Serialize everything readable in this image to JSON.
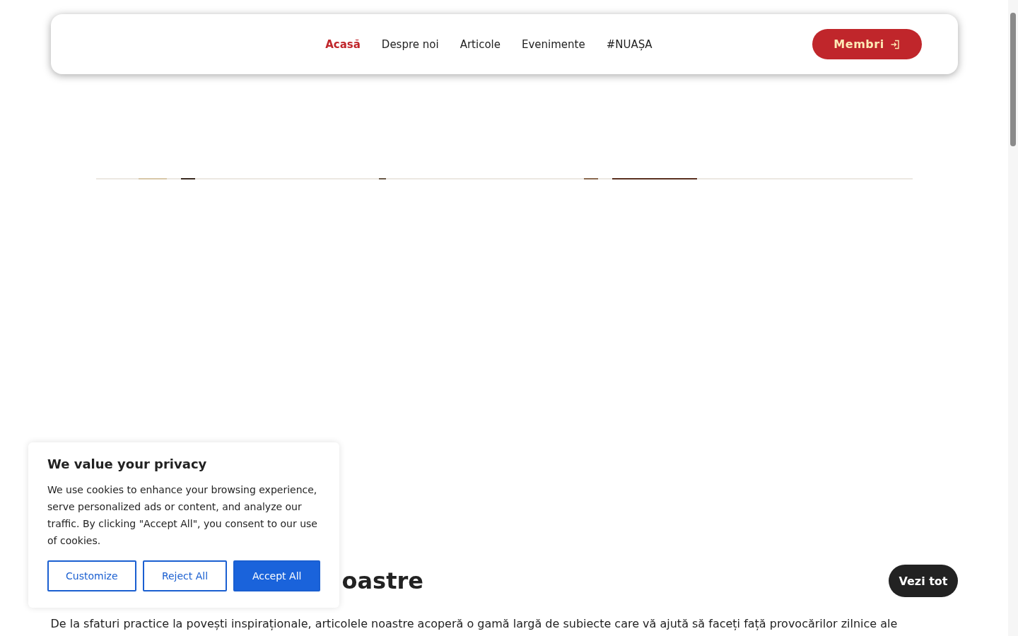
{
  "header": {
    "nav": [
      {
        "label": "Acasă",
        "selected": true
      },
      {
        "label": "Despre noi",
        "selected": false
      },
      {
        "label": "Articole",
        "selected": false
      },
      {
        "label": "Evenimente",
        "selected": false
      },
      {
        "label": "#NUAȘA",
        "selected": false
      }
    ],
    "members_button": "Membri"
  },
  "articles": {
    "heading": "oastre",
    "see_all": "Vezi tot",
    "intro": "De la sfaturi practice la povești inspiraționale, articolele noastre acoperă o gamă largă de subiecte care vă ajută să faceți față provocărilor zilnice ale"
  },
  "cookie_banner": {
    "title": "We value your privacy",
    "text": "We use cookies to enhance your browsing experience, serve personalized ads or content, and analyze our traffic. By clicking \"Accept All\", you consent to our use of cookies.",
    "buttons": [
      {
        "label": "Customize",
        "kind": "outline"
      },
      {
        "label": "Reject All",
        "kind": "outline"
      },
      {
        "label": "Accept All",
        "kind": "primary"
      }
    ]
  }
}
